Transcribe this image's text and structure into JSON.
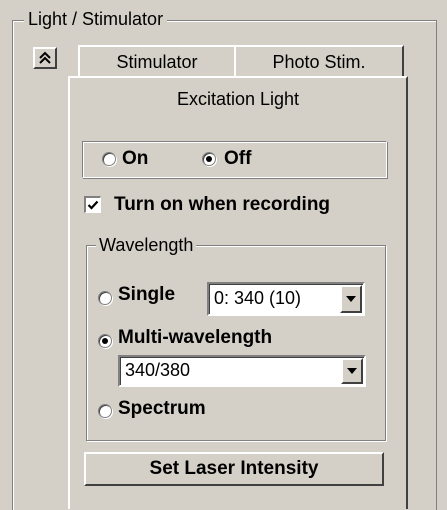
{
  "group": {
    "title": "Light / Stimulator"
  },
  "collapse_button": {
    "icon": "double-chevron-up-icon"
  },
  "tabs": [
    {
      "label": "Stimulator"
    },
    {
      "label": "Photo Stim."
    },
    {
      "label": "Excitation Light",
      "selected": true
    }
  ],
  "power": {
    "on_label": "On",
    "off_label": "Off",
    "selected": "Off"
  },
  "turn_on_recording": {
    "label": "Turn on when recording",
    "checked": true
  },
  "wavelength": {
    "legend": "Wavelength",
    "single_label": "Single",
    "single_value": "0: 340 (10)",
    "multi_label": "Multi-wavelength",
    "multi_value": "340/380",
    "spectrum_label": "Spectrum",
    "selected": "Multi-wavelength"
  },
  "laser_button": {
    "label": "Set Laser Intensity"
  }
}
